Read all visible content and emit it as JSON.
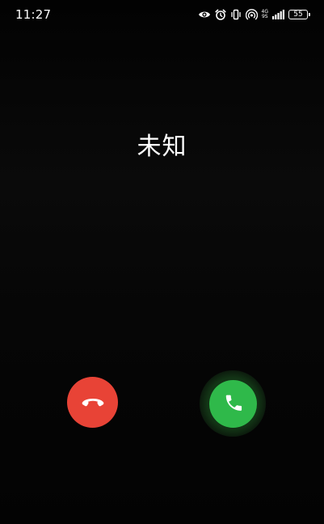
{
  "status_bar": {
    "time": "11:27",
    "icons": [
      "eye-icon",
      "alarm-icon",
      "vibrate-icon",
      "hotspot-icon",
      "signal-icon",
      "battery-icon"
    ],
    "network_top": "4G",
    "network_bottom": "9S",
    "battery_level": "55"
  },
  "call": {
    "caller_name": "未知"
  },
  "actions": {
    "decline_icon": "phone-hangup-icon",
    "answer_icon": "phone-answer-icon",
    "decline_color": "#e84336",
    "answer_color": "#2fb94a"
  }
}
